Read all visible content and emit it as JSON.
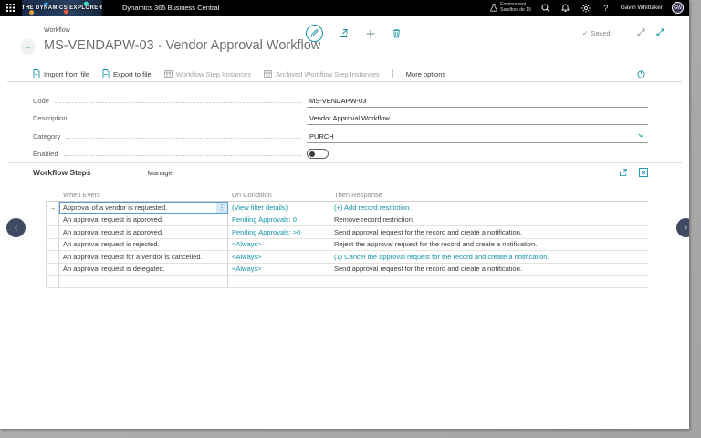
{
  "colors": {
    "topbar_bg": "#000000",
    "accent_teal": "#1292a5",
    "selection_blue": "#5a9bd5",
    "disabled_gray": "#a19f9d"
  },
  "topbar": {
    "logo_text": "THE DYNAMICS EXPLORER",
    "app_title": "Dynamics 365 Business Central",
    "environment": {
      "line1": "Environment",
      "line2": "Sandbox de 19"
    },
    "user_name": "Gavin Whittaker",
    "avatar_initials": "GW",
    "help_label": "?"
  },
  "page": {
    "breadcrumb": "Workflow",
    "title": "MS-VENDAPW-03 · Vendor Approval Workflow",
    "save_status": "Saved",
    "save_check": "✓",
    "back_arrow": "←"
  },
  "action_bar": {
    "import": "Import from file",
    "export": "Export to file",
    "step_instances": "Workflow Step Instances",
    "archived_instances": "Archived Workflow Step Instances",
    "more_options": "More options"
  },
  "fields": {
    "code": {
      "label": "Code",
      "value": "MS-VENDAPW-03"
    },
    "description": {
      "label": "Description",
      "value": "Vendor Approval Workflow"
    },
    "category": {
      "label": "Category",
      "value": "PURCH"
    },
    "enabled": {
      "label": "Enabled",
      "state": "off"
    }
  },
  "steps": {
    "title": "Workflow Steps",
    "menu": "Manage",
    "columns": {
      "event": "When Event",
      "condition": "On Condition",
      "response": "Then Response"
    },
    "selected_row_arrow": "→",
    "row_menu_glyph": "⋮",
    "rows": [
      {
        "event": "Approval of a vendor is requested.",
        "condition": "(View filter details)",
        "response": "(+) Add record restriction."
      },
      {
        "event": "An approval request is approved.",
        "condition": "Pending Approvals: 0",
        "response": "Remove record restriction."
      },
      {
        "event": "An approval request is approved.",
        "condition": "Pending Approvals: >0",
        "response": "Send approval request for the record and create a notification."
      },
      {
        "event": "An approval request is rejected.",
        "condition": "<Always>",
        "response": "Reject the approval request for the record and create a notification."
      },
      {
        "event": "An approval request for a vendor is cancelled.",
        "condition": "<Always>",
        "response": "(1) Cancel the approval request for the record and create a notification."
      },
      {
        "event": "An approval request is delegated.",
        "condition": "<Always>",
        "response": "Send approval request for the record and create a notification."
      }
    ]
  },
  "nav": {
    "prev": "‹",
    "next": "›"
  }
}
